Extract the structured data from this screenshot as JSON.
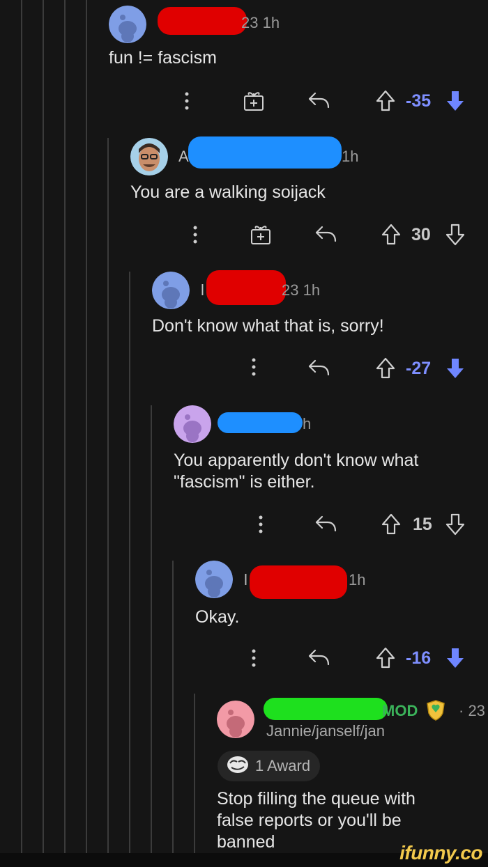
{
  "comments": [
    {
      "meta_suffix": "23 1h",
      "body": "fun != fascism",
      "score": "-35",
      "vote": "down",
      "has_award_button": true
    },
    {
      "meta_prefix": "A",
      "meta_suffix": "1h",
      "body": "You are a walking soijack",
      "score": "30",
      "vote": "none",
      "has_award_button": true
    },
    {
      "meta_prefix": "l",
      "meta_suffix": "23 1h",
      "body": "Don't know what that is, sorry!",
      "score": "-27",
      "vote": "down",
      "has_award_button": false
    },
    {
      "meta_suffix": "h",
      "body_line1": "You apparently don't know what",
      "body_line2": "\"fascism\" is either.",
      "score": "15",
      "vote": "none",
      "has_award_button": false
    },
    {
      "meta_prefix": "l",
      "meta_suffix": "1h",
      "body": "Okay.",
      "score": "-16",
      "vote": "down",
      "has_award_button": false
    },
    {
      "mod_tag": "MOD",
      "time": "· 23",
      "flair": "Jannie/janself/jan",
      "award_label": "1 Award",
      "body_line1": "Stop filling the queue with",
      "body_line2": "false reports or you'll be",
      "body_line3": "banned"
    }
  ],
  "watermark": "ifunny.co",
  "colors": {
    "downvote": "#7e8fff",
    "redaction_red": "#e00000",
    "redaction_blue": "#1e8fff",
    "redaction_green": "#1ee01e"
  }
}
